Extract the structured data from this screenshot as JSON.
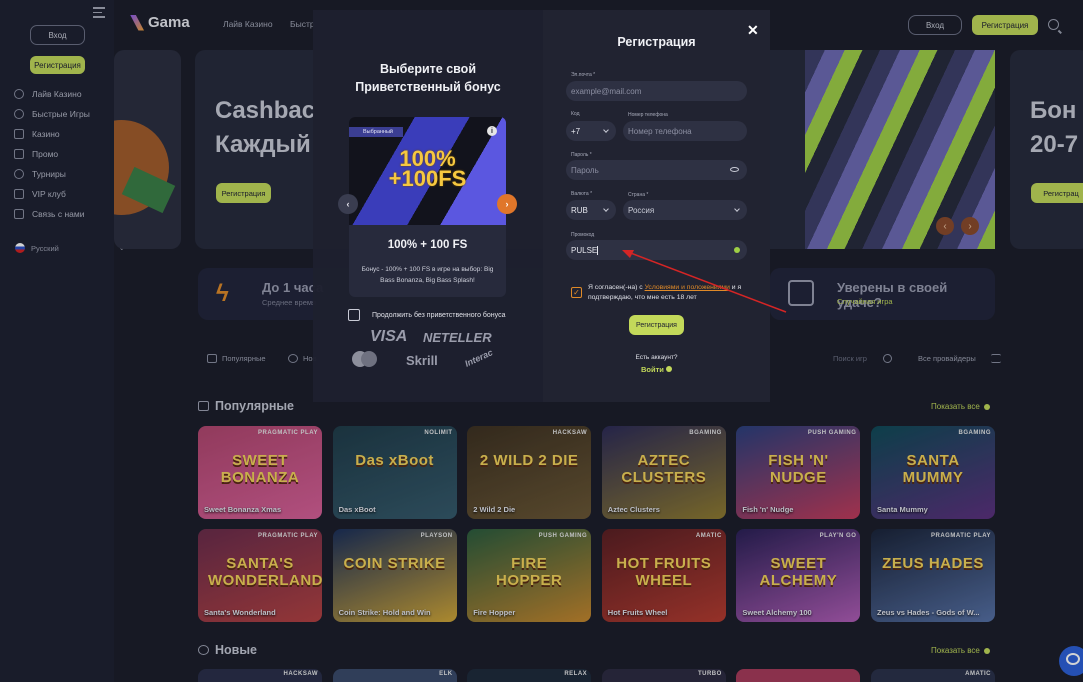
{
  "sidebar": {
    "login": "Вход",
    "register": "Регистрация",
    "items": [
      "Лайв Казино",
      "Быстрые Игры",
      "Казино",
      "Промо",
      "Турниры",
      "VIP клуб",
      "Связь с нами"
    ],
    "language": "Русский"
  },
  "header": {
    "logo": "Gama",
    "nav": [
      "Лайв Казино",
      "Быстр"
    ],
    "login": "Вход",
    "register": "Регистрация"
  },
  "banners": {
    "b2_title_1": "Cashbac",
    "b2_title_2": "Каждый",
    "b2_register": "Регистрация",
    "b3_title_1": "Бон",
    "b3_title_2": "20-7",
    "b3_register": "Регистрац",
    "prev": "‹",
    "next": "›"
  },
  "info": {
    "i1_title": "До 1 часа",
    "i1_sub": "Среднее время",
    "i2_title": "Уверены в своей удаче?",
    "i2_sub": "Случайная игра"
  },
  "filters": {
    "popular": "Популярные",
    "new": "Нов",
    "search_placeholder": "Поиск игр",
    "providers": "Все провайдеры"
  },
  "sections": {
    "popular": "Популярные",
    "new": "Новые",
    "show_all": "Показать все"
  },
  "games_row1": [
    {
      "name": "Sweet Bonanza Xmas",
      "provider": "PRAGMATIC PLAY",
      "art": "SWEET BONANZA"
    },
    {
      "name": "Das xBoot",
      "provider": "NOLIMIT",
      "art": "Das xBoot"
    },
    {
      "name": "2 Wild 2 Die",
      "provider": "HACKSAW",
      "art": "2 WILD 2 DIE"
    },
    {
      "name": "Aztec Clusters",
      "provider": "BGAMING",
      "art": "AZTEC CLUSTERS"
    },
    {
      "name": "Fish 'n' Nudge",
      "provider": "PUSH GAMING",
      "art": "FISH 'N' NUDGE"
    },
    {
      "name": "Santa Mummy",
      "provider": "BGAMING",
      "art": "SANTA MUMMY"
    }
  ],
  "games_row2": [
    {
      "name": "Santa's Wonderland",
      "provider": "PRAGMATIC PLAY",
      "art": "SANTA'S WONDERLAND"
    },
    {
      "name": "Coin Strike: Hold and Win",
      "provider": "PLAYSON",
      "art": "COIN STRIKE"
    },
    {
      "name": "Fire Hopper",
      "provider": "PUSH GAMING",
      "art": "FIRE HOPPER"
    },
    {
      "name": "Hot Fruits Wheel",
      "provider": "AMATIC",
      "art": "HOT FRUITS WHEEL"
    },
    {
      "name": "Sweet Alchemy 100",
      "provider": "PLAY'N GO",
      "art": "SWEET ALCHEMY"
    },
    {
      "name": "Zeus vs Hades - Gods of W...",
      "provider": "PRAGMATIC PLAY",
      "art": "ZEUS HADES"
    }
  ],
  "games_row3_providers": [
    "HACKSAW",
    "ELK",
    "RELAX",
    "TURBO",
    "",
    "AMATIC"
  ],
  "modal": {
    "bonus_heading": "Выберите свой Приветственный бонус",
    "badge": "Выбранный",
    "bonus_image_text_1": "100%",
    "bonus_image_text_2": "+100FS",
    "bonus_title": "100% + 100 FS",
    "bonus_desc": "Бонус - 100% + 100 FS в игре на выбор: Big Bass Bonanza, Big Bass Splash!",
    "no_bonus": "Продолжить без приветственного бонуса",
    "payments": [
      "VISA",
      "NETELLER",
      "mastercard",
      "Skrill",
      "Interac"
    ],
    "title": "Регистрация",
    "close": "✕",
    "email_label": "Эл.почта *",
    "email_placeholder": "example@mail.com",
    "code_label": "Код",
    "code_value": "+7",
    "phone_label": "Номер телефона",
    "phone_placeholder": "Номер телефона",
    "password_label": "Пароль *",
    "password_placeholder": "Пароль",
    "currency_label": "Валюта *",
    "currency_value": "RUB",
    "country_label": "Страна *",
    "country_value": "Россия",
    "promo_label": "Промокод",
    "promo_value": "PULSE",
    "agree_1": "Я согласен(-на) с ",
    "agree_link": "Условиями и положениями",
    "agree_2": " и я подтверждаю, что мне есть 18 лет",
    "submit": "Регистрация",
    "has_account": "Есть аккаунт?",
    "login": "Войти"
  },
  "colors": {
    "accent": "#c3d95a",
    "orange": "#e08a28",
    "annotation_arrow": "#d42525"
  }
}
